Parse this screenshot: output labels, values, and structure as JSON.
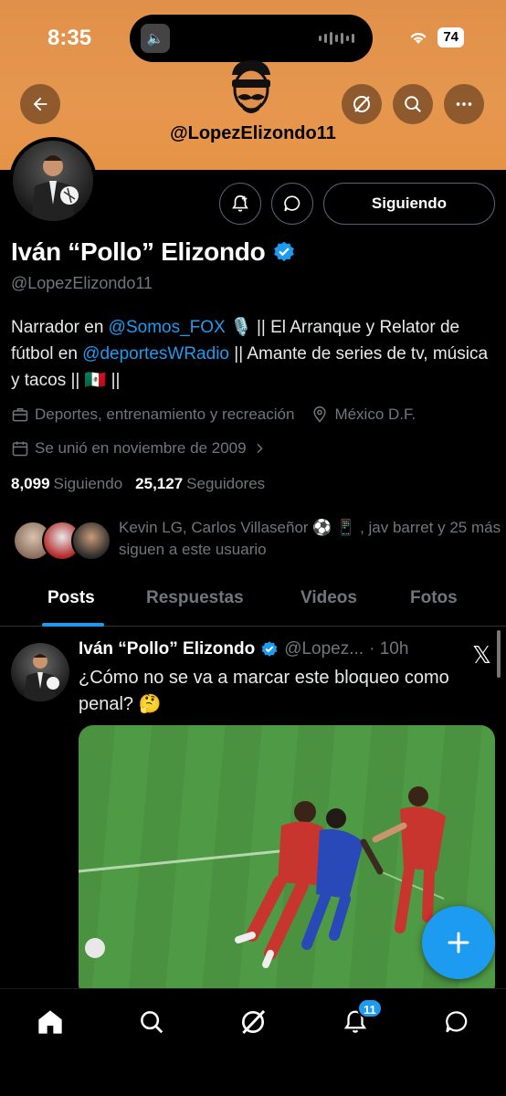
{
  "status_bar": {
    "time": "8:35",
    "battery": "74"
  },
  "banner": {
    "handle": "@LopezElizondo11"
  },
  "profile": {
    "name": "Iván “Pollo” Elizondo",
    "handle": "@LopezElizondo11",
    "follow_button": "Siguiendo",
    "bio": {
      "p1": "Narrador en ",
      "link1": "@Somos_FOX",
      "emoji1": "🎙️",
      "p2": " || El Arranque y Relator de fútbol en ",
      "link2": "@deportesWRadio",
      "p3": " || Amante de series de tv, música y tacos || ",
      "emoji2": "🇲🇽",
      "p4": " ||"
    },
    "category": "Deportes, entrenamiento y recreación",
    "location": "México D.F.",
    "joined": "Se unió en noviembre de 2009",
    "following_count": "8,099",
    "following_label": "Siguiendo",
    "followers_count": "25,127",
    "followers_label": "Seguidores",
    "followed_by": "Kevin LG, Carlos Villaseñor ⚽️ 📱 , jav barret y 25 más siguen a este usuario"
  },
  "tabs": [
    "Posts",
    "Respuestas",
    "Videos",
    "Fotos"
  ],
  "post": {
    "name": "Iván “Pollo” Elizondo",
    "handle": "@Lopez...",
    "time": "· 10h",
    "text": "¿Cómo no se va a marcar este bloqueo como penal? 🤔",
    "x_logo": "𝕏"
  },
  "nav": {
    "notifications_badge": "11"
  },
  "colors": {
    "accent": "#1d9bf0",
    "banner": "#e59346",
    "background": "#000000"
  }
}
